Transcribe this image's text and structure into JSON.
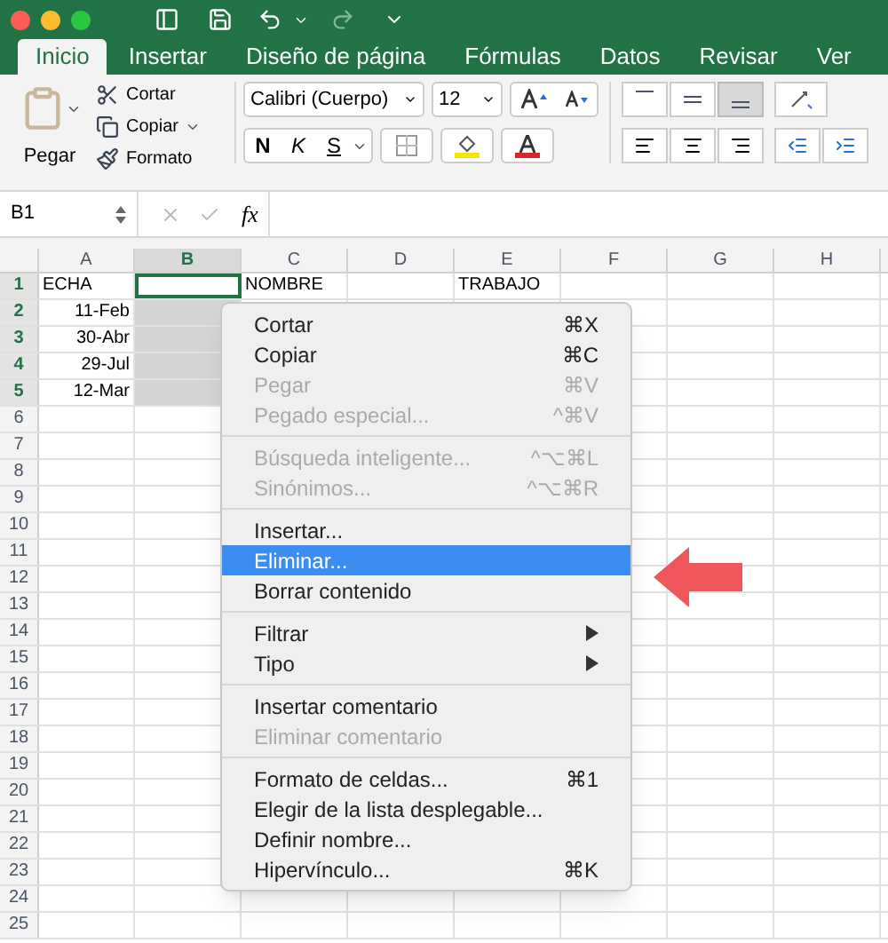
{
  "tabs": [
    {
      "label": "Inicio",
      "selected": true
    },
    {
      "label": "Insertar",
      "selected": false
    },
    {
      "label": "Diseño de página",
      "selected": false
    },
    {
      "label": "Fórmulas",
      "selected": false
    },
    {
      "label": "Datos",
      "selected": false
    },
    {
      "label": "Revisar",
      "selected": false
    },
    {
      "label": "Ver",
      "selected": false
    }
  ],
  "ribbon": {
    "paste_label": "Pegar",
    "clipboard_items": [
      "Cortar",
      "Copiar",
      "Formato"
    ],
    "font_name": "Calibri (Cuerpo)",
    "font_size": "12",
    "style_buttons": [
      "N",
      "K",
      "S"
    ]
  },
  "formula_bar": {
    "name_box": "B1",
    "function_label": "fx"
  },
  "sheet": {
    "columns": [
      {
        "label": "A",
        "selected": false
      },
      {
        "label": "B",
        "selected": true
      },
      {
        "label": "C",
        "selected": false
      },
      {
        "label": "D",
        "selected": false
      },
      {
        "label": "E",
        "selected": false
      },
      {
        "label": "F",
        "selected": false
      },
      {
        "label": "G",
        "selected": false
      },
      {
        "label": "H",
        "selected": false
      }
    ],
    "rows": [
      {
        "number": "1",
        "selected": true,
        "cells": {
          "A": "ECHA",
          "C": "NOMBRE",
          "E": "TRABAJO"
        }
      },
      {
        "number": "2",
        "selected": true,
        "cells": {
          "A": "11-Feb"
        }
      },
      {
        "number": "3",
        "selected": true,
        "cells": {
          "A": "30-Abr"
        }
      },
      {
        "number": "4",
        "selected": true,
        "cells": {
          "A": "29-Jul"
        }
      },
      {
        "number": "5",
        "selected": true,
        "cells": {
          "A": "12-Mar"
        }
      },
      {
        "number": "6",
        "selected": false,
        "cells": {}
      },
      {
        "number": "7",
        "selected": false,
        "cells": {}
      },
      {
        "number": "8",
        "selected": false,
        "cells": {}
      },
      {
        "number": "9",
        "selected": false,
        "cells": {}
      },
      {
        "number": "10",
        "selected": false,
        "cells": {}
      },
      {
        "number": "11",
        "selected": false,
        "cells": {}
      },
      {
        "number": "12",
        "selected": false,
        "cells": {}
      },
      {
        "number": "13",
        "selected": false,
        "cells": {}
      },
      {
        "number": "14",
        "selected": false,
        "cells": {}
      },
      {
        "number": "15",
        "selected": false,
        "cells": {}
      },
      {
        "number": "16",
        "selected": false,
        "cells": {}
      },
      {
        "number": "17",
        "selected": false,
        "cells": {}
      },
      {
        "number": "18",
        "selected": false,
        "cells": {}
      },
      {
        "number": "19",
        "selected": false,
        "cells": {}
      },
      {
        "number": "20",
        "selected": false,
        "cells": {}
      },
      {
        "number": "21",
        "selected": false,
        "cells": {}
      },
      {
        "number": "22",
        "selected": false,
        "cells": {}
      },
      {
        "number": "23",
        "selected": false,
        "cells": {}
      },
      {
        "number": "24",
        "selected": false,
        "cells": {}
      },
      {
        "number": "25",
        "selected": false,
        "cells": {}
      }
    ]
  },
  "context_menu": {
    "groups": [
      [
        {
          "label": "Cortar",
          "shortcut": "⌘X",
          "disabled": false,
          "selected": false,
          "submenu": false
        },
        {
          "label": "Copiar",
          "shortcut": "⌘C",
          "disabled": false,
          "selected": false,
          "submenu": false
        },
        {
          "label": "Pegar",
          "shortcut": "⌘V",
          "disabled": true,
          "selected": false,
          "submenu": false
        },
        {
          "label": "Pegado especial...",
          "shortcut": "^⌘V",
          "disabled": true,
          "selected": false,
          "submenu": false
        }
      ],
      [
        {
          "label": "Búsqueda inteligente...",
          "shortcut": "^⌥⌘L",
          "disabled": true,
          "selected": false,
          "submenu": false
        },
        {
          "label": "Sinónimos...",
          "shortcut": "^⌥⌘R",
          "disabled": true,
          "selected": false,
          "submenu": false
        }
      ],
      [
        {
          "label": "Insertar...",
          "disabled": false,
          "selected": false,
          "submenu": false
        },
        {
          "label": "Eliminar...",
          "disabled": false,
          "selected": true,
          "submenu": false
        },
        {
          "label": "Borrar contenido",
          "disabled": false,
          "selected": false,
          "submenu": false
        }
      ],
      [
        {
          "label": "Filtrar",
          "disabled": false,
          "selected": false,
          "submenu": true
        },
        {
          "label": "Tipo",
          "disabled": false,
          "selected": false,
          "submenu": true
        }
      ],
      [
        {
          "label": "Insertar comentario",
          "disabled": false,
          "selected": false,
          "submenu": false
        },
        {
          "label": "Eliminar comentario",
          "disabled": true,
          "selected": false,
          "submenu": false
        }
      ],
      [
        {
          "label": "Formato de celdas...",
          "shortcut": "⌘1",
          "disabled": false,
          "selected": false,
          "submenu": false
        },
        {
          "label": "Elegir de la lista desplegable...",
          "disabled": false,
          "selected": false,
          "submenu": false
        },
        {
          "label": "Definir nombre...",
          "disabled": false,
          "selected": false,
          "submenu": false
        },
        {
          "label": "Hipervínculo...",
          "shortcut": "⌘K",
          "disabled": false,
          "selected": false,
          "submenu": false
        }
      ]
    ]
  }
}
